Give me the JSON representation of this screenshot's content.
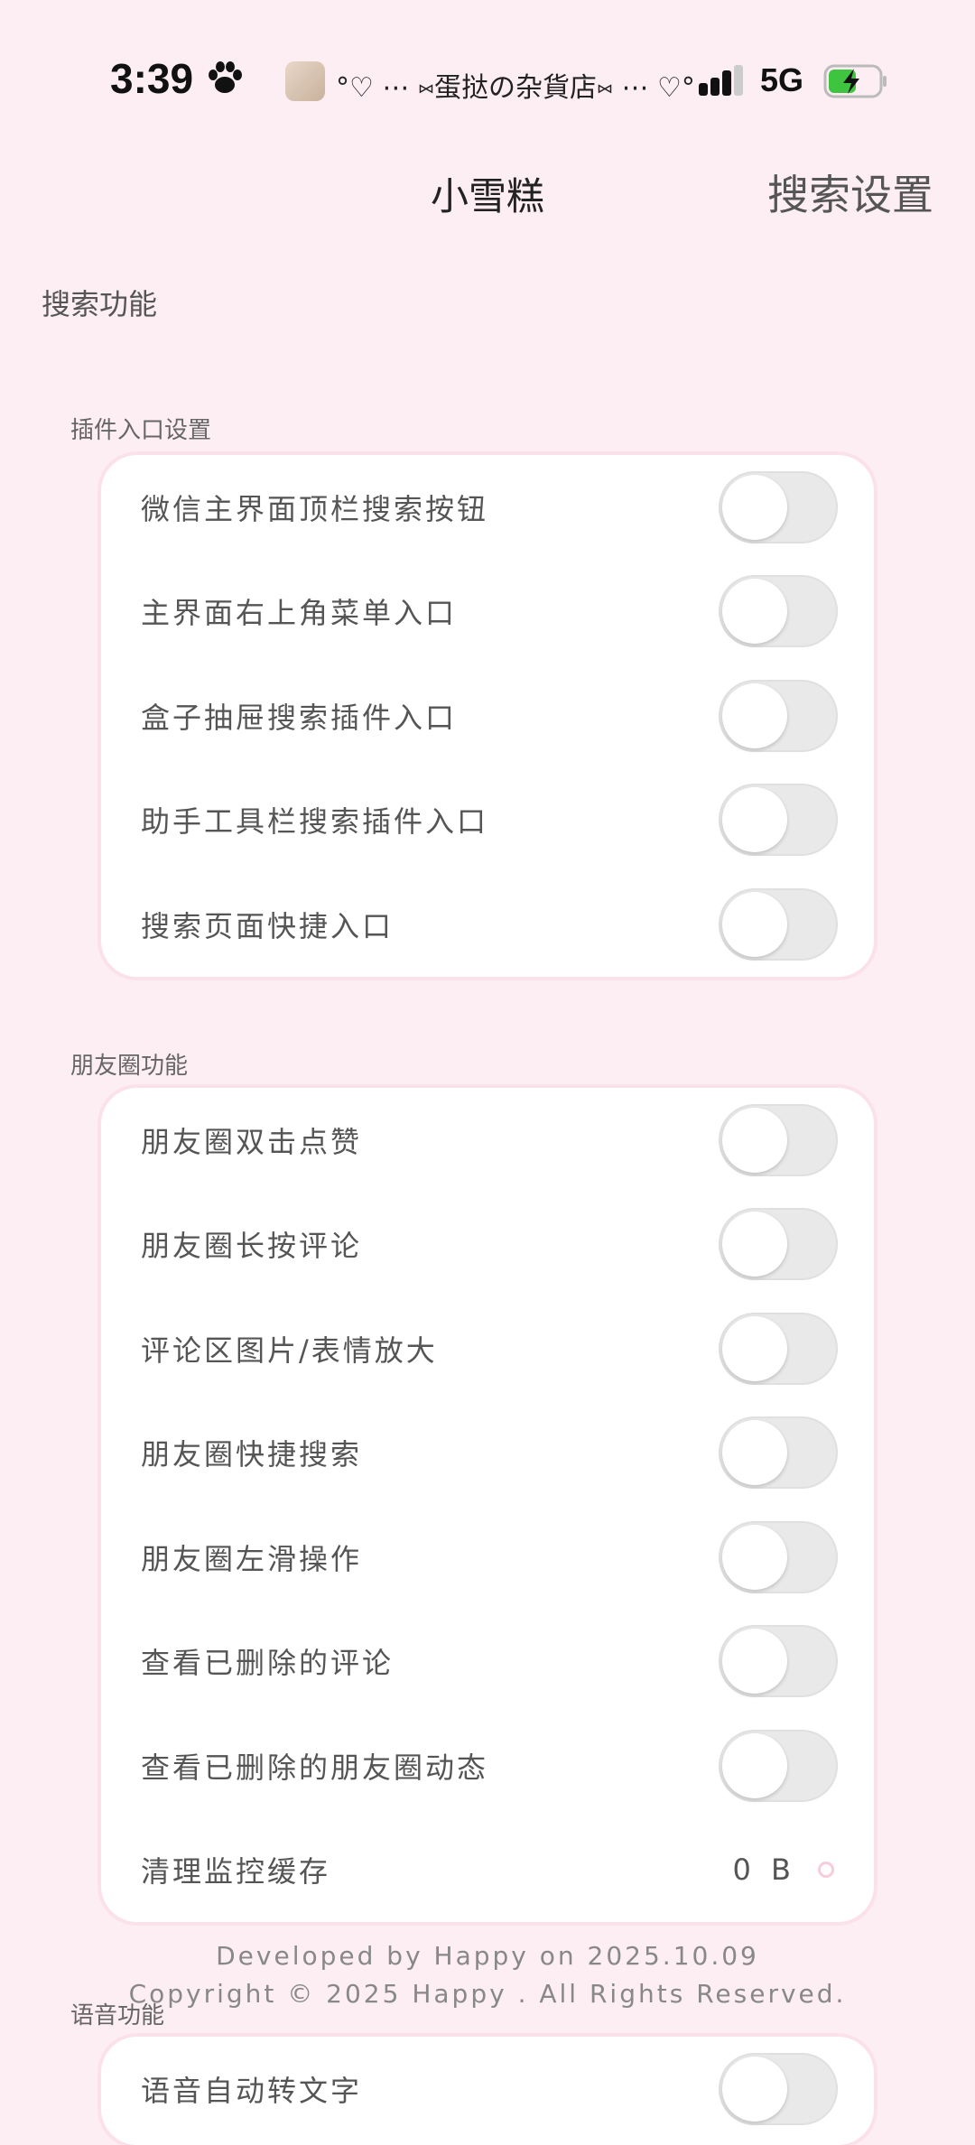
{
  "status_bar": {
    "time": "3:39",
    "marquee": "°♡ ⋯ ⑅蛋挞の杂貨店⑅ ⋯ ♡°",
    "network": "5G",
    "icons": [
      "paw-icon",
      "signal-icon",
      "battery-charging-icon"
    ]
  },
  "topbar": {
    "title": "小雪糕",
    "right_title": "搜索设置"
  },
  "section_title": "搜索功能",
  "groups": [
    {
      "label": "插件入口设置",
      "items": [
        {
          "label": "微信主界面顶栏搜索按钮",
          "on": false
        },
        {
          "label": "主界面右上角菜单入口",
          "on": false
        },
        {
          "label": "盒子抽屉搜索插件入口",
          "on": false
        },
        {
          "label": "助手工具栏搜索插件入口",
          "on": false
        },
        {
          "label": "搜索页面快捷入口",
          "on": false
        }
      ]
    },
    {
      "label": "朋友圈功能",
      "items": [
        {
          "label": "朋友圈双击点赞",
          "on": false
        },
        {
          "label": "朋友圈长按评论",
          "on": false
        },
        {
          "label": "评论区图片/表情放大",
          "on": false
        },
        {
          "label": "朋友圈快捷搜索",
          "on": false
        },
        {
          "label": "朋友圈左滑操作",
          "on": false
        },
        {
          "label": "查看已删除的评论",
          "on": false
        },
        {
          "label": "查看已删除的朋友圈动态",
          "on": false
        },
        {
          "label": "清理监控缓存",
          "value": "0 B"
        }
      ]
    },
    {
      "label": "语音功能",
      "items": [
        {
          "label": "语音自动转文字",
          "on": false
        }
      ]
    }
  ],
  "footer": {
    "line1": "Developed by Happy  on 2025.10.09",
    "line2": "Copyright © 2025 Happy . All Rights Reserved."
  },
  "colors": {
    "background": "#fdeef4",
    "card": "#ffffff",
    "card_border": "#fbe1ea",
    "toggle_off": "#e9e9e9"
  }
}
